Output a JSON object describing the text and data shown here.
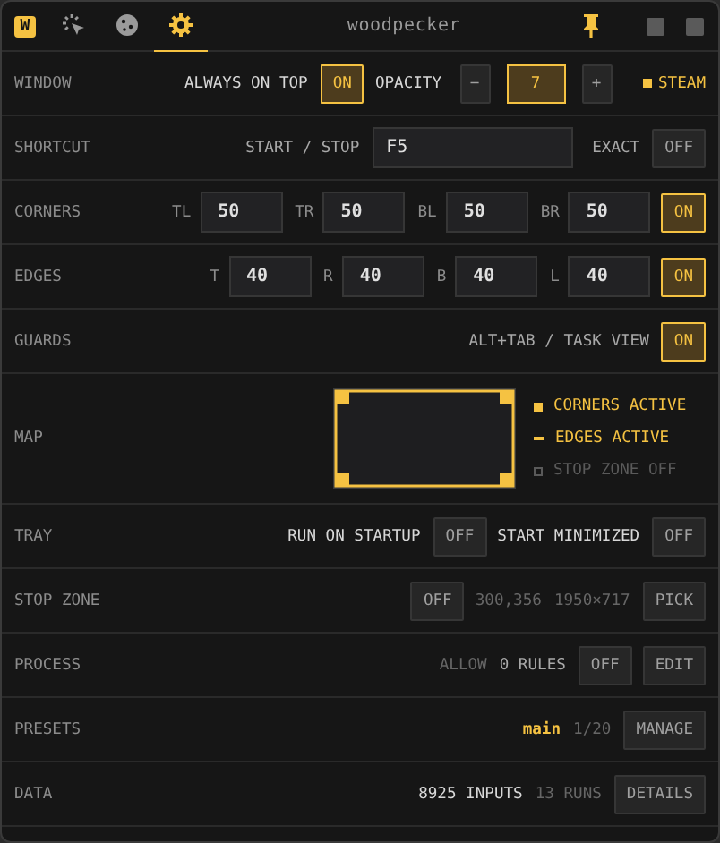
{
  "header": {
    "logo": "W",
    "tabs": [
      {
        "kind": "click",
        "selected": false
      },
      {
        "kind": "cookie",
        "selected": false
      },
      {
        "kind": "settings",
        "selected": true
      }
    ],
    "title": "woodpecker",
    "pinned": true
  },
  "rows": [
    {
      "label": "WINDOW",
      "items": [
        {
          "kind": "label",
          "text": "ALWAYS ON TOP"
        },
        {
          "kind": "toggle",
          "label": "ON",
          "on": true
        },
        {
          "kind": "label",
          "text": "OPACITY"
        },
        {
          "kind": "button",
          "label": "−"
        },
        {
          "kind": "value",
          "value": "7"
        },
        {
          "kind": "button",
          "label": "+"
        },
        {
          "kind": "status",
          "label": "STEAM"
        }
      ]
    },
    {
      "label": "SHORTCUT",
      "items": [
        {
          "kind": "note",
          "text": "START / STOP"
        },
        {
          "kind": "hotkey",
          "value": "F5"
        },
        {
          "kind": "note",
          "text": "EXACT"
        },
        {
          "kind": "toggle",
          "label": "OFF",
          "on": false
        }
      ]
    },
    {
      "label": "CORNERS",
      "items": [
        {
          "kind": "field",
          "prefix": "TL",
          "value": "50"
        },
        {
          "kind": "field",
          "prefix": "TR",
          "value": "50"
        },
        {
          "kind": "field",
          "prefix": "BL",
          "value": "50"
        },
        {
          "kind": "field",
          "prefix": "BR",
          "value": "50"
        },
        {
          "kind": "toggle",
          "label": "ON",
          "on": true
        }
      ]
    },
    {
      "label": "EDGES",
      "items": [
        {
          "kind": "field",
          "prefix": "T",
          "value": "40"
        },
        {
          "kind": "field",
          "prefix": "R",
          "value": "40"
        },
        {
          "kind": "field",
          "prefix": "B",
          "value": "40"
        },
        {
          "kind": "field",
          "prefix": "L",
          "value": "40"
        },
        {
          "kind": "toggle",
          "label": "ON",
          "on": true
        }
      ]
    },
    {
      "label": "GUARDS",
      "items": [
        {
          "kind": "note",
          "text": "ALT+TAB / TASK VIEW"
        },
        {
          "kind": "toggle",
          "label": "ON",
          "on": true
        }
      ]
    },
    {
      "label": "MAP",
      "items": [
        {
          "kind": "map",
          "legend": [
            {
              "kind": "corner",
              "text": "CORNERS ACTIVE",
              "active": true
            },
            {
              "kind": "edge",
              "text": "EDGES ACTIVE",
              "active": true
            },
            {
              "kind": "zone",
              "text": "STOP ZONE OFF",
              "active": false
            }
          ]
        }
      ]
    },
    {
      "label": "TRAY",
      "items": [
        {
          "kind": "label",
          "text": "RUN ON STARTUP"
        },
        {
          "kind": "toggle",
          "label": "OFF",
          "on": false
        },
        {
          "kind": "label",
          "text": "START MINIMIZED"
        },
        {
          "kind": "toggle",
          "label": "OFF",
          "on": false
        }
      ]
    },
    {
      "label": "STOP ZONE",
      "items": [
        {
          "kind": "toggle",
          "label": "OFF",
          "on": false
        },
        {
          "kind": "muted",
          "text": "300,356"
        },
        {
          "kind": "muted",
          "text": "1950×717"
        },
        {
          "kind": "button",
          "label": "PICK"
        }
      ]
    },
    {
      "label": "PROCESS",
      "items": [
        {
          "kind": "muted",
          "text": "ALLOW"
        },
        {
          "kind": "note",
          "text": "0 RULES"
        },
        {
          "kind": "toggle",
          "label": "OFF",
          "on": false
        },
        {
          "kind": "button",
          "label": "EDIT"
        }
      ]
    },
    {
      "label": "PRESETS",
      "items": [
        {
          "kind": "highlight",
          "text": "main"
        },
        {
          "kind": "muted",
          "text": "1/20"
        },
        {
          "kind": "button",
          "label": "MANAGE"
        }
      ]
    },
    {
      "label": "DATA",
      "items": [
        {
          "kind": "label",
          "text": "8925 INPUTS"
        },
        {
          "kind": "muted",
          "text": "13 RUNS"
        },
        {
          "kind": "button",
          "label": "DETAILS"
        }
      ]
    }
  ]
}
